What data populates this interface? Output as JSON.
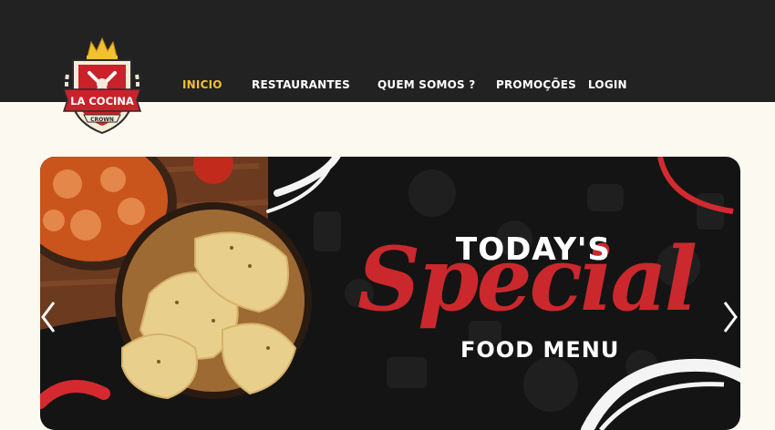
{
  "brand": {
    "logo_line1": "LA COCINA",
    "logo_line2": "CROWN",
    "colors": {
      "topbar": "#222222",
      "accent": "#f2c12e",
      "background": "#fcf9f1",
      "banner_red": "#d42a2f"
    }
  },
  "nav": {
    "items": [
      {
        "label": "INICIO",
        "active": true
      },
      {
        "label": "RESTAURANTES",
        "active": false
      },
      {
        "label": "QUEM SOMOS ?",
        "active": false
      },
      {
        "label": "PROMOÇÕES",
        "active": false
      },
      {
        "label": "LOGIN",
        "active": false
      }
    ]
  },
  "hero": {
    "line1": "TODAY'S",
    "script": "Special",
    "line3": "FOOD MENU",
    "prev_icon": "chevron-left-icon",
    "next_icon": "chevron-right-icon"
  }
}
